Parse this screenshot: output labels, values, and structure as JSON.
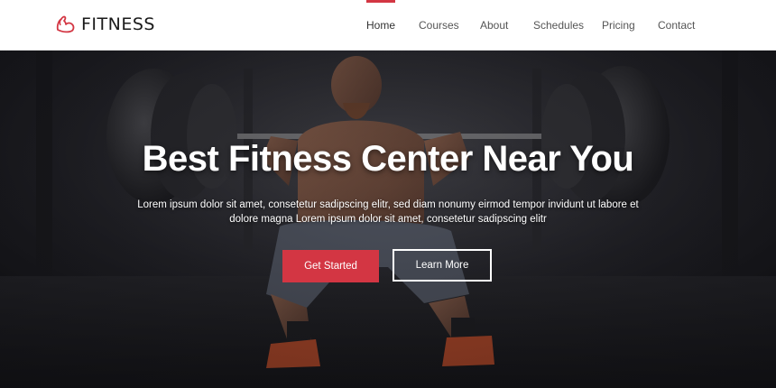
{
  "brand": {
    "name": "FITNESS",
    "logo_icon": "flexed-arm-icon",
    "accent": "#d33643"
  },
  "nav": {
    "items": [
      {
        "label": "Home",
        "active": true
      },
      {
        "label": "Courses",
        "active": false
      },
      {
        "label": "About",
        "active": false
      },
      {
        "label": "Schedules",
        "active": false
      },
      {
        "label": "Pricing",
        "active": false
      },
      {
        "label": "Contact",
        "active": false
      }
    ]
  },
  "hero": {
    "title": "Best Fitness Center Near You",
    "subtitle": "Lorem ipsum dolor sit amet, consetetur sadipscing elitr, sed diam nonumy eirmod tempor invidunt ut labore et dolore magna Lorem ipsum dolor sit amet, consetetur sadipscing elitr",
    "primary_button": "Get Started",
    "secondary_button": "Learn More",
    "background": "weightlifter-squat-photo"
  }
}
